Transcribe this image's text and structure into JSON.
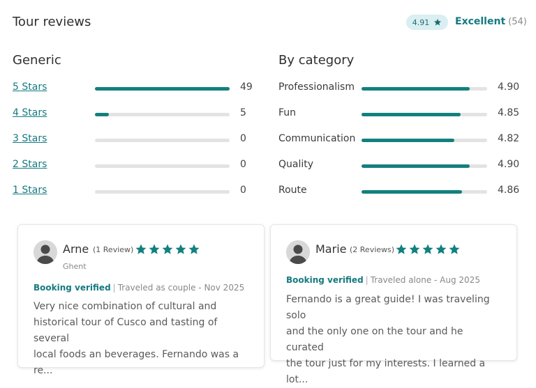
{
  "header": {
    "title": "Tour reviews",
    "rating": "4.91",
    "rating_label": "Excellent",
    "rating_count": "(54)"
  },
  "generic": {
    "title": "Generic",
    "rows": [
      {
        "label": "5 Stars",
        "value": "49",
        "fill": 1.0
      },
      {
        "label": "4 Stars",
        "value": "5",
        "fill": 0.102
      },
      {
        "label": "3 Stars",
        "value": "0",
        "fill": 0
      },
      {
        "label": "2 Stars",
        "value": "0",
        "fill": 0
      },
      {
        "label": "1 Stars",
        "value": "0",
        "fill": 0
      }
    ]
  },
  "category": {
    "title": "By category",
    "rows": [
      {
        "label": "Professionalism",
        "value": "4.90",
        "fill": 0.86
      },
      {
        "label": "Fun",
        "value": "4.85",
        "fill": 0.79
      },
      {
        "label": "Communication",
        "value": "4.82",
        "fill": 0.74
      },
      {
        "label": "Quality",
        "value": "4.90",
        "fill": 0.86
      },
      {
        "label": "Route",
        "value": "4.86",
        "fill": 0.8
      }
    ]
  },
  "reviews": [
    {
      "name": "Arne",
      "review_count": "(1 Review)",
      "location": "Ghent",
      "verified": "Booking verified",
      "traveled": "Traveled as couple - Nov 2025",
      "text_lines": [
        "Very nice combination of cultural and",
        "historical tour of Cusco and tasting of several",
        "local foods an beverages. Fernando was a re..."
      ],
      "stars": 5
    },
    {
      "name": "Marie",
      "review_count": "(2 Reviews)",
      "location": "",
      "verified": "Booking verified",
      "traveled": "Traveled alone - Aug 2025",
      "text_lines": [
        "Fernando is a great guide! I was traveling solo",
        "and the only one on the tour and he curated",
        "the tour just for my interests. I learned a lot..."
      ],
      "stars": 5
    }
  ],
  "colors": {
    "accent": "#157a80",
    "bar_fill": "#12807f",
    "bar_track": "#e3e3e3",
    "pill_bg": "#d9eff2"
  },
  "icons": {
    "star": "star-icon",
    "avatar": "user-avatar-icon"
  }
}
